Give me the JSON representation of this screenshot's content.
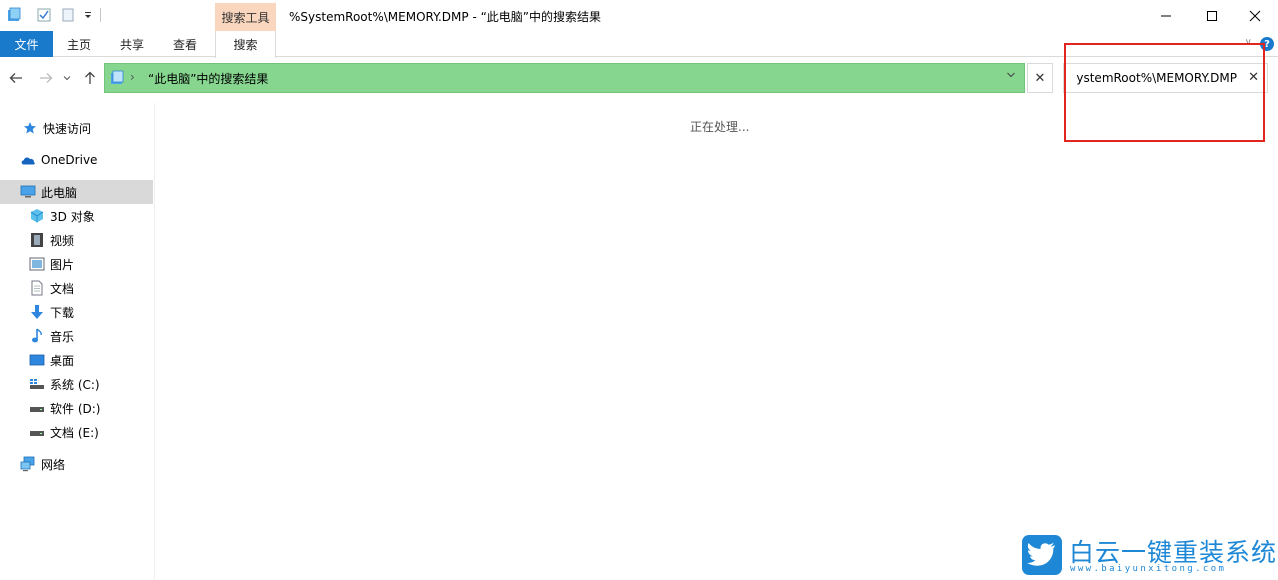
{
  "titlebar": {
    "context_tab": "搜索工具",
    "title": "%SystemRoot%\\MEMORY.DMP - “此电脑”中的搜索结果",
    "minimize_icon": "minimize-icon",
    "maximize_icon": "maximize-icon",
    "close_icon": "close-icon"
  },
  "ribbon": {
    "tabs": [
      {
        "label": "文件"
      },
      {
        "label": "主页"
      },
      {
        "label": "共享"
      },
      {
        "label": "查看"
      },
      {
        "label": "搜索"
      }
    ],
    "help": "?"
  },
  "navigation": {
    "address_text": "“此电脑”中的搜索结果",
    "address_color": "#86d68f",
    "search_value": "ystemRoot%\\MEMORY.DMP",
    "clear_label": "✕"
  },
  "sidebar": {
    "items": [
      {
        "label": "快速访问",
        "icon": "star-icon"
      },
      {
        "label": "OneDrive",
        "icon": "cloud-icon"
      },
      {
        "label": "此电脑",
        "icon": "computer-icon"
      },
      {
        "label": "3D 对象",
        "icon": "cube-icon"
      },
      {
        "label": "视频",
        "icon": "video-icon"
      },
      {
        "label": "图片",
        "icon": "picture-icon"
      },
      {
        "label": "文档",
        "icon": "document-icon"
      },
      {
        "label": "下载",
        "icon": "download-icon"
      },
      {
        "label": "音乐",
        "icon": "music-icon"
      },
      {
        "label": "桌面",
        "icon": "desktop-icon"
      },
      {
        "label": "系统 (C:)",
        "icon": "drive-c-icon"
      },
      {
        "label": "软件 (D:)",
        "icon": "drive-d-icon"
      },
      {
        "label": "文档 (E:)",
        "icon": "drive-e-icon"
      },
      {
        "label": "网络",
        "icon": "network-icon"
      }
    ]
  },
  "content": {
    "status": "正在处理..."
  },
  "watermark": {
    "main": "白云一键重装系统",
    "sub": "www.baiyunxitong.com",
    "color": "#1e88d6"
  }
}
